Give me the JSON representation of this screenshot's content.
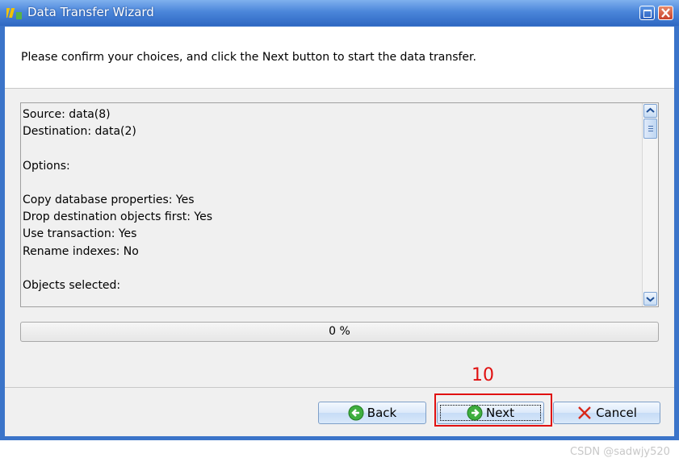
{
  "window": {
    "title": "Data Transfer Wizard"
  },
  "header": {
    "instruction": "Please confirm your choices, and click the Next button to start the data transfer."
  },
  "summary": {
    "lines": [
      "Source: data(8)",
      "Destination: data(2)",
      "",
      "Options:",
      "",
      "Copy database properties: Yes",
      "Drop destination objects first: Yes",
      "Use transaction: Yes",
      "Rename indexes: No",
      "",
      "Objects selected:"
    ]
  },
  "progress": {
    "value": 0,
    "label": "0 %"
  },
  "buttons": {
    "back": "Back",
    "next": "Next",
    "cancel": "Cancel"
  },
  "annotation": {
    "step_number": "10",
    "color": "#e01010"
  },
  "watermark": "CSDN @sadwjy520",
  "icons": {
    "app": "data-transfer-icon",
    "back": "arrow-left-circle-icon",
    "next": "arrow-right-circle-icon",
    "cancel": "x-mark-icon"
  }
}
